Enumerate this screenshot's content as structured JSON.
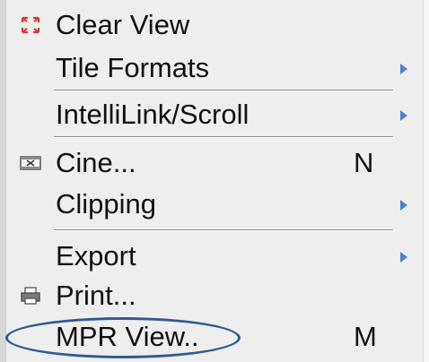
{
  "menu": {
    "items": [
      {
        "label": "Clear View",
        "icon": "clear-view-icon",
        "shortcut": "",
        "submenu": false
      },
      {
        "label": "Tile Formats",
        "icon": "",
        "shortcut": "",
        "submenu": true
      },
      {
        "label": "IntelliLink/Scroll",
        "icon": "",
        "shortcut": "",
        "submenu": true
      },
      {
        "label": "Cine...",
        "icon": "film-icon",
        "shortcut": "N",
        "submenu": false
      },
      {
        "label": "Clipping",
        "icon": "",
        "shortcut": "",
        "submenu": true
      },
      {
        "label": "Export",
        "icon": "",
        "shortcut": "",
        "submenu": true
      },
      {
        "label": "Print...",
        "icon": "printer-icon",
        "shortcut": "",
        "submenu": false
      },
      {
        "label": "MPR View..",
        "icon": "",
        "shortcut": "M",
        "submenu": false
      }
    ]
  },
  "colors": {
    "menu_background": "#eeeeee",
    "submenu_arrow": "#4f82cc",
    "highlight_oval": "#2d5d91"
  }
}
